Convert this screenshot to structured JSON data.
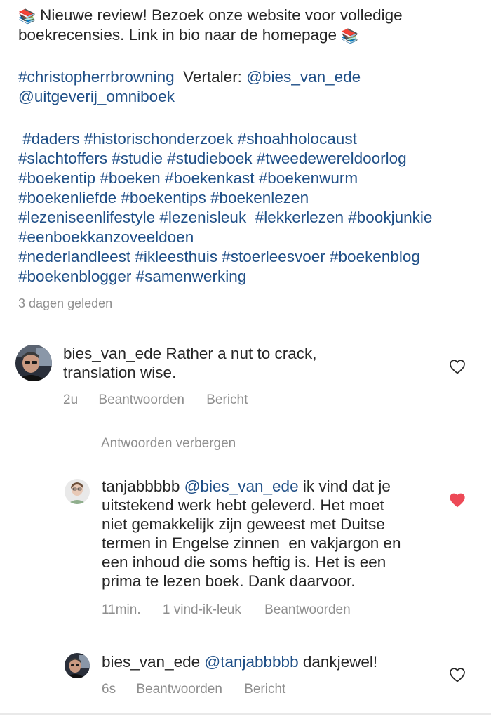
{
  "post": {
    "caption_emoji": "📚",
    "caption_line1": "Nieuwe review! Bezoek onze website voor volledige",
    "caption_line2": "boekrecensies. Link in bio naar de homepage",
    "author_tag": "#christopherrbrowning",
    "translator_label": "Vertaler:",
    "translator_mention": "@bies_van_ede",
    "publisher_mention": "@uitgeverij_omniboek",
    "hashtag_lines": [
      " #daders #historischonderzoek #shoahholocaust",
      "#slachtoffers #studie #studieboek #tweedewereldoorlog",
      "#boekentip #boeken #boekenkast #boekenwurm",
      "#boekenliefde #boekentips #boekenlezen",
      "#lezeniseenlifestyle #lezenisleuk  #lekkerlezen #bookjunkie",
      "#eenboekkanzoveeldoen",
      "#nederlandleest #ikleesthuis #stoerleesvoer #boekenblog",
      "#boekenblogger #samenwerking"
    ],
    "time_ago": "3 dagen geleden"
  },
  "comments": [
    {
      "username": "bies_van_ede",
      "text_line1": " Rather a nut to crack,",
      "text_line2": "translation wise.",
      "time": "2u",
      "reply_label": "Beantwoorden",
      "message_label": "Bericht",
      "liked": false
    }
  ],
  "replies_toggle": "Antwoorden verbergen",
  "replies": [
    {
      "username": "tanjabbbbb",
      "mention": "@bies_van_ede",
      "lines": [
        " ik vind dat je",
        "uitstekend werk hebt geleverd. Het moet",
        "niet gemakkelijk zijn geweest met Duitse",
        "termen in Engelse zinnen  en vakjargon en",
        "een inhoud die soms heftig is. Het is een",
        "prima te lezen boek. Dank daarvoor."
      ],
      "time": "11min.",
      "likes_label": "1 vind-ik-leuk",
      "reply_label": "Beantwoorden",
      "liked": true
    },
    {
      "username": "bies_van_ede",
      "mention": "@tanjabbbbb",
      "text": " dankjewel!",
      "time": "6s",
      "reply_label": "Beantwoorden",
      "message_label": "Bericht",
      "liked": false
    }
  ],
  "colors": {
    "link": "#1f4f87",
    "meta": "#8e8e8e",
    "heart_liked": "#ed4956",
    "heart_outline": "#262626"
  },
  "icons": {
    "book_emoji": "books-emoji-icon",
    "like": "heart-icon"
  }
}
